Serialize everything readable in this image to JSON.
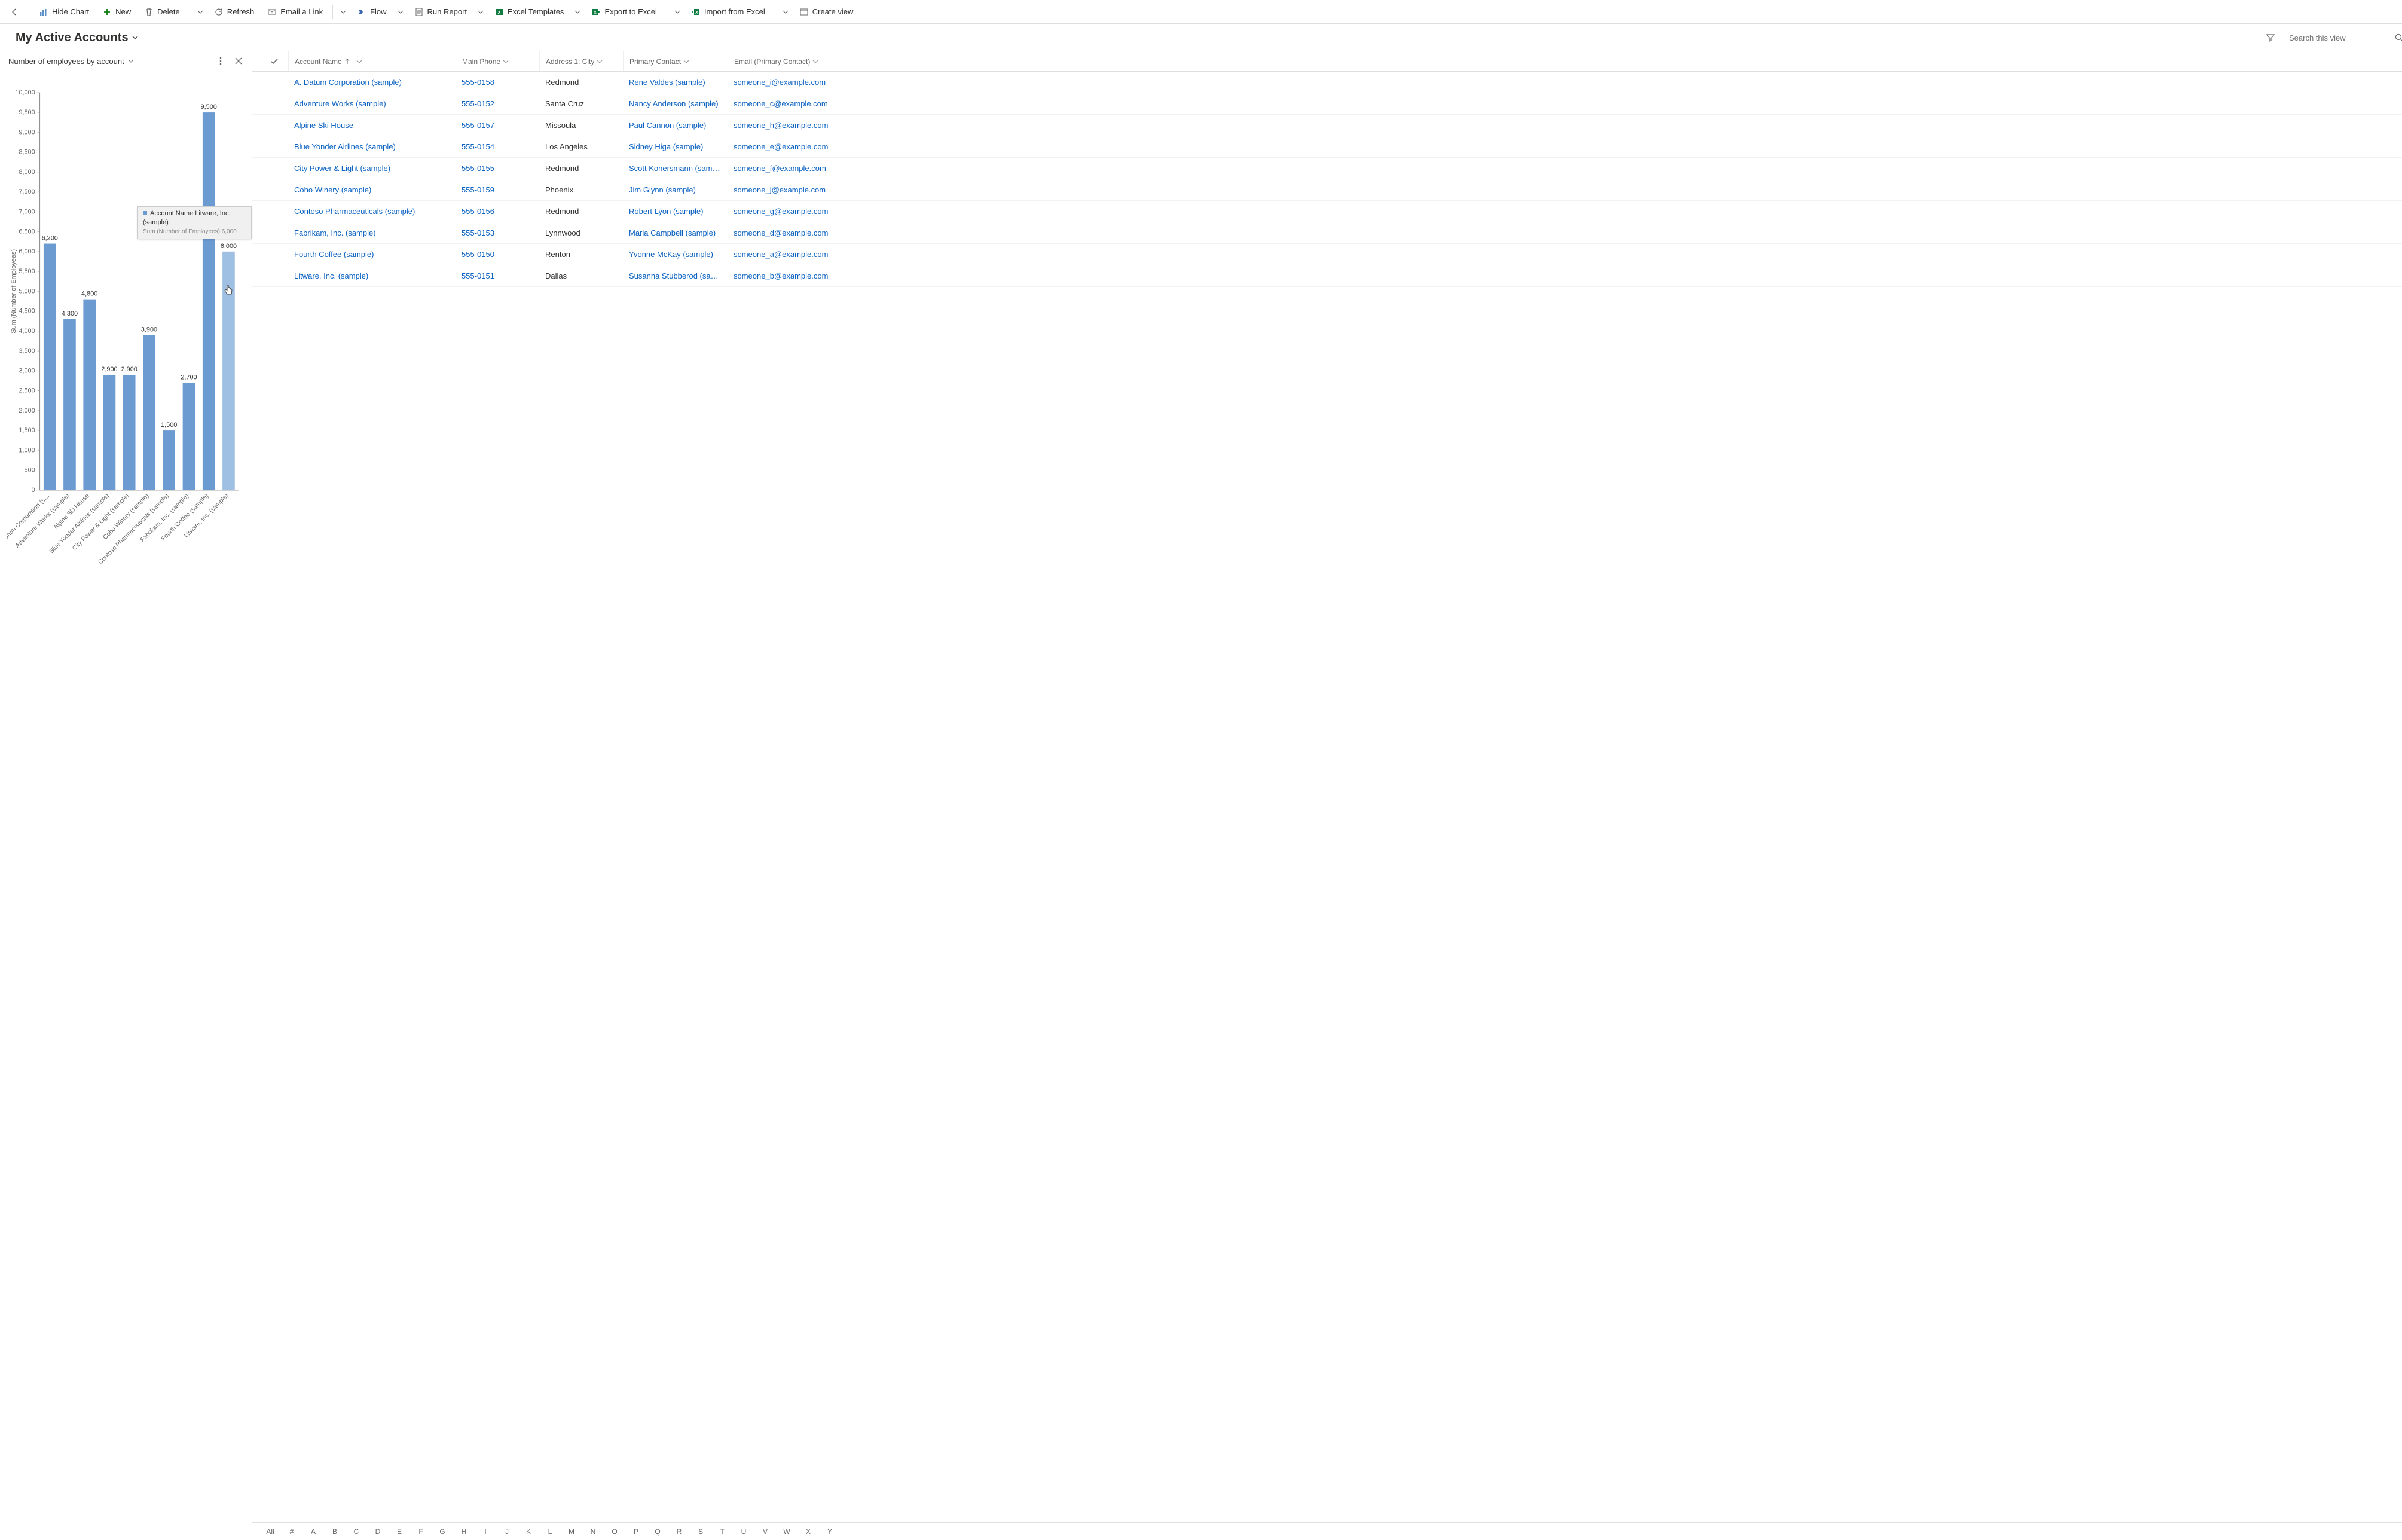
{
  "toolbar": {
    "back": "←",
    "hide_chart": "Hide Chart",
    "new": "New",
    "delete": "Delete",
    "refresh": "Refresh",
    "email_link": "Email a Link",
    "flow": "Flow",
    "run_report": "Run Report",
    "excel_templates": "Excel Templates",
    "export_excel": "Export to Excel",
    "import_excel": "Import from Excel",
    "create_view": "Create view"
  },
  "header": {
    "view_name": "My Active Accounts",
    "search_placeholder": "Search this view"
  },
  "chart": {
    "title": "Number of employees by account",
    "y_axis_label": "Sum (Number of Employees)",
    "tooltip_line1": "Account Name:Litware, Inc. (sample)",
    "tooltip_line2": "Sum (Number of Employees):6,000"
  },
  "chart_data": {
    "type": "bar",
    "title": "Number of employees by account",
    "ylabel": "Sum (Number of Employees)",
    "ylim": [
      0,
      10000
    ],
    "ytick_interval": 500,
    "categories": [
      "A. Datum Corporation (s…",
      "Adventure Works (sample)",
      "Alpine Ski House",
      "Blue Yonder Airlines (sample)",
      "City Power & Light (sample)",
      "Coho Winery (sample)",
      "Contoso Pharmaceuticals (sample)",
      "Fabrikam, Inc. (sample)",
      "Fourth Coffee (sample)",
      "Litware, Inc. (sample)"
    ],
    "values": [
      6200,
      4300,
      4800,
      2900,
      2900,
      3900,
      1500,
      2700,
      9500,
      6000
    ],
    "hover_index": 9
  },
  "grid": {
    "columns": {
      "name": "Account Name",
      "phone": "Main Phone",
      "city": "Address 1: City",
      "contact": "Primary Contact",
      "email": "Email (Primary Contact)"
    },
    "rows": [
      {
        "name": "A. Datum Corporation (sample)",
        "phone": "555-0158",
        "city": "Redmond",
        "contact": "Rene Valdes (sample)",
        "email": "someone_i@example.com"
      },
      {
        "name": "Adventure Works (sample)",
        "phone": "555-0152",
        "city": "Santa Cruz",
        "contact": "Nancy Anderson (sample)",
        "email": "someone_c@example.com"
      },
      {
        "name": "Alpine Ski House",
        "phone": "555-0157",
        "city": "Missoula",
        "contact": "Paul Cannon (sample)",
        "email": "someone_h@example.com"
      },
      {
        "name": "Blue Yonder Airlines (sample)",
        "phone": "555-0154",
        "city": "Los Angeles",
        "contact": "Sidney Higa (sample)",
        "email": "someone_e@example.com"
      },
      {
        "name": "City Power & Light (sample)",
        "phone": "555-0155",
        "city": "Redmond",
        "contact": "Scott Konersmann (sample)",
        "email": "someone_f@example.com"
      },
      {
        "name": "Coho Winery (sample)",
        "phone": "555-0159",
        "city": "Phoenix",
        "contact": "Jim Glynn (sample)",
        "email": "someone_j@example.com"
      },
      {
        "name": "Contoso Pharmaceuticals (sample)",
        "phone": "555-0156",
        "city": "Redmond",
        "contact": "Robert Lyon (sample)",
        "email": "someone_g@example.com"
      },
      {
        "name": "Fabrikam, Inc. (sample)",
        "phone": "555-0153",
        "city": "Lynnwood",
        "contact": "Maria Campbell (sample)",
        "email": "someone_d@example.com"
      },
      {
        "name": "Fourth Coffee (sample)",
        "phone": "555-0150",
        "city": "Renton",
        "contact": "Yvonne McKay (sample)",
        "email": "someone_a@example.com"
      },
      {
        "name": "Litware, Inc. (sample)",
        "phone": "555-0151",
        "city": "Dallas",
        "contact": "Susanna Stubberod (sample)",
        "email": "someone_b@example.com"
      }
    ]
  },
  "alpha": [
    "All",
    "#",
    "A",
    "B",
    "C",
    "D",
    "E",
    "F",
    "G",
    "H",
    "I",
    "J",
    "K",
    "L",
    "M",
    "N",
    "O",
    "P",
    "Q",
    "R",
    "S",
    "T",
    "U",
    "V",
    "W",
    "X",
    "Y"
  ]
}
